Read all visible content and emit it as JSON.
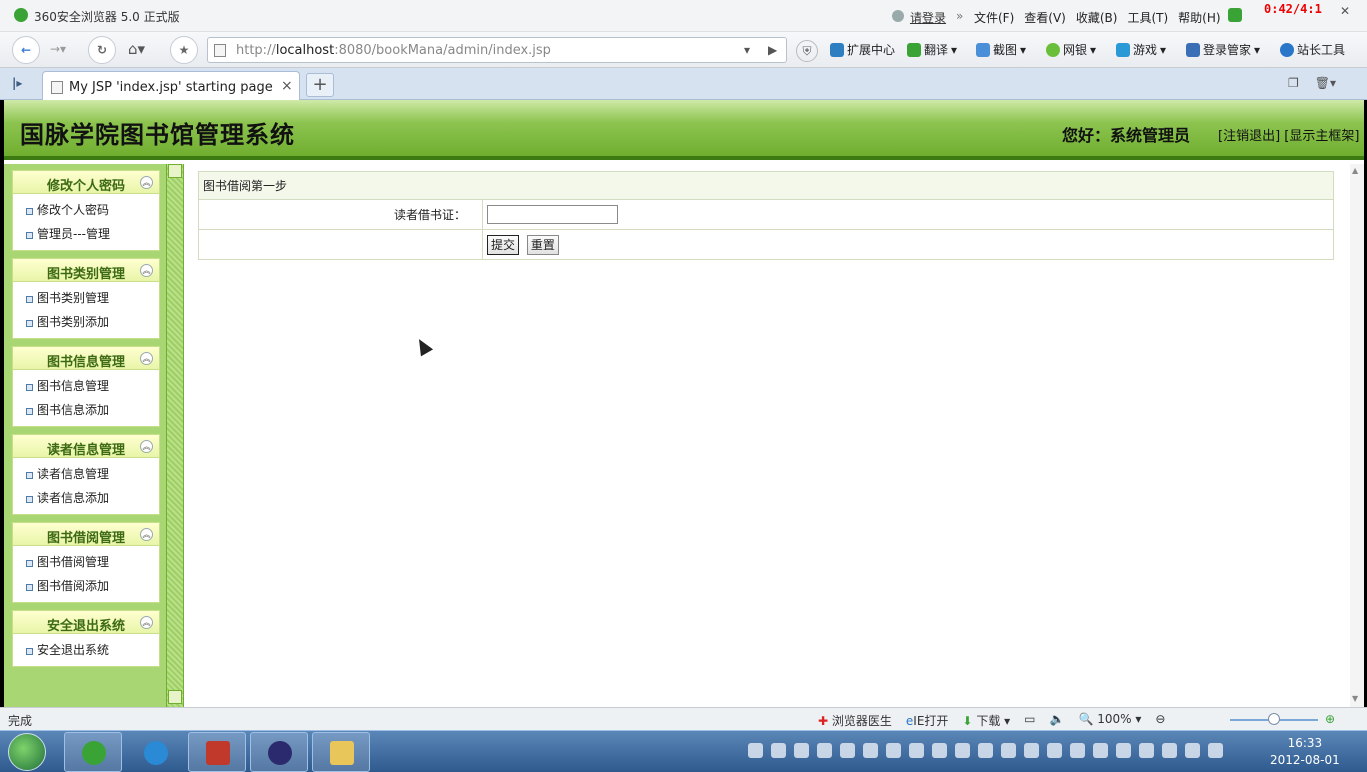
{
  "browser": {
    "app_title": "360安全浏览器 5.0 正式版",
    "login_link": "请登录",
    "menu": [
      "文件(F)",
      "查看(V)",
      "收藏(B)",
      "工具(T)",
      "帮助(H)"
    ],
    "timer": "0:42/4:1",
    "url_prefix": "http://",
    "url_host": "localhost",
    "url_rest": ":8080/bookMana/admin/index.jsp",
    "toolbar": [
      "扩展中心",
      "翻译",
      "截图",
      "网银",
      "游戏",
      "登录管家",
      "站长工具"
    ],
    "tab_label": "My JSP 'index.jsp' starting page",
    "tab_close": "×",
    "new_tab": "+"
  },
  "header": {
    "system_title": "国脉学院图书馆管理系统",
    "greeting": "您好：系统管理员",
    "logout_link": "[注销退出]",
    "main_frame_link": "[显示主框架]"
  },
  "sidebar": {
    "groups": [
      {
        "title": "修改个人密码",
        "items": [
          "修改个人密码",
          "管理员---管理"
        ]
      },
      {
        "title": "图书类别管理",
        "items": [
          "图书类别管理",
          "图书类别添加"
        ]
      },
      {
        "title": "图书信息管理",
        "items": [
          "图书信息管理",
          "图书信息添加"
        ]
      },
      {
        "title": "读者信息管理",
        "items": [
          "读者信息管理",
          "读者信息添加"
        ]
      },
      {
        "title": "图书借阅管理",
        "items": [
          "图书借阅管理",
          "图书借阅添加"
        ]
      },
      {
        "title": "安全退出系统",
        "items": [
          "安全退出系统"
        ]
      }
    ]
  },
  "form": {
    "caption": "图书借阅第一步",
    "reader_label": "读者借书证：",
    "reader_value": "",
    "submit_label": "提交",
    "reset_label": "重置"
  },
  "statusbar": {
    "status": "完成",
    "items": [
      "浏览器医生",
      "IE打开",
      "下载",
      "100%"
    ]
  },
  "taskbar": {
    "time": "16:33",
    "date": "2012-08-01"
  },
  "colors": {
    "header_green": "#6fae2f",
    "sidebar_green": "#a8d672"
  }
}
